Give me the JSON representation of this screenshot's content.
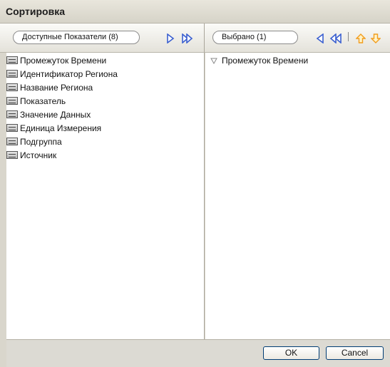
{
  "dialog": {
    "title": "Сортировка"
  },
  "available": {
    "header_label": "Доступные Показатели (8)",
    "items": [
      "Промежуток Времени",
      "Идентификатор Региона",
      "Название Региона",
      "Показатель",
      "Значение Данных",
      "Единица Измерения",
      "Подгруппа",
      "Источник"
    ]
  },
  "selected": {
    "header_label": "Выбрано (1)",
    "items": [
      "Промежуток Времени"
    ]
  },
  "buttons": {
    "ok": "OK",
    "cancel": "Cancel"
  },
  "colors": {
    "arrow_blue": "#3a5fd0",
    "arrow_orange": "#f29d1c",
    "button_border": "#003c74"
  }
}
